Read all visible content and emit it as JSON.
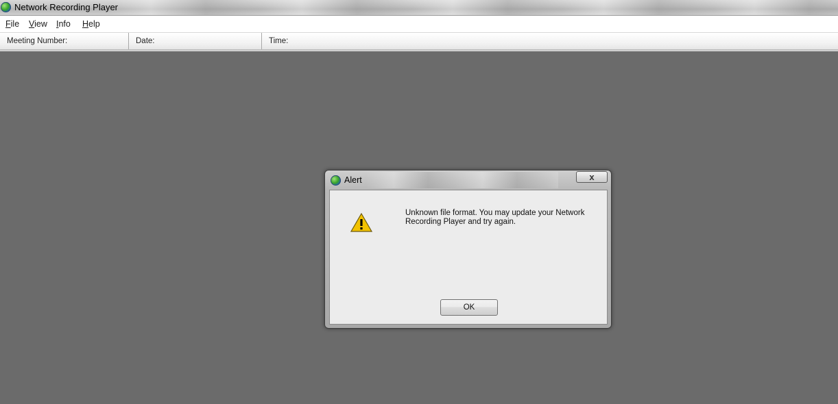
{
  "window": {
    "title": "Network Recording Player",
    "icon": "globe-icon"
  },
  "menu": [
    {
      "label": "File",
      "key": "F",
      "rest": "ile"
    },
    {
      "label": "View",
      "key": "V",
      "rest": "iew"
    },
    {
      "label": "Info",
      "key": "I",
      "rest": "nfo"
    },
    {
      "label": "Help",
      "key": "H",
      "rest": "elp"
    }
  ],
  "header": {
    "meeting_label": "Meeting Number:",
    "date_label": "Date:",
    "time_label": "Time:"
  },
  "dialog": {
    "title": "Alert",
    "close_label": "x",
    "message": "Unknown file format. You may update your Network Recording Player and try again.",
    "ok_label": "OK",
    "warning_icon": "warning-icon"
  },
  "colors": {
    "workspace": "#6b6b6b",
    "warning_yellow": "#f2c200"
  }
}
